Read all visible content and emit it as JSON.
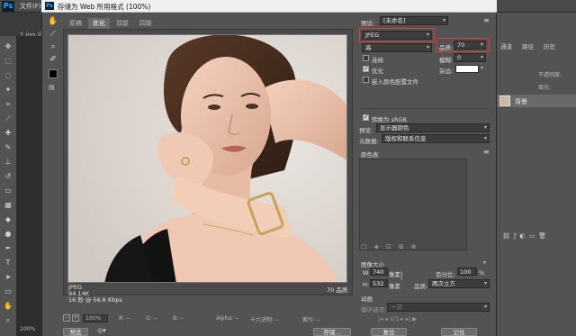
{
  "app": {
    "logo": "Ps",
    "menu_file": "文件(F)",
    "doc_tab": "1.jpg @ 5",
    "zoom": "100%"
  },
  "dialog": {
    "title": "存储为 Web 所用格式 (100%)",
    "tabs": [
      {
        "label": "原稿"
      },
      {
        "label": "优化"
      },
      {
        "label": "双联"
      },
      {
        "label": "四联"
      }
    ],
    "info": {
      "format": "JPEG",
      "size": "94.14K",
      "download": "16 秒 @ 56.6 Kbps",
      "quality": "70 品质"
    },
    "bottom_bar": {
      "zoom": "100%",
      "r": "R: --",
      "g": "G: --",
      "b": "B: --",
      "alpha": "Alpha: --",
      "hex": "十六进制: --",
      "index": "索引: --"
    },
    "buttons": {
      "preview": "预览",
      "save": "存储...",
      "reset": "复位",
      "remember": "记住"
    }
  },
  "settings": {
    "preset_label": "预设:",
    "preset_value": "[未命名]",
    "format_value": "JPEG",
    "compression_value": "高",
    "quality_label": "品质:",
    "quality_value": "70",
    "progressive_label": "连续",
    "blur_label": "模糊:",
    "blur_value": "0",
    "optimized_label": "优化",
    "matte_label": "杂边:",
    "embed_profile_label": "嵌入颜色配置文件",
    "convert_srgb_label": "转换为 sRGB",
    "preview_label": "预览:",
    "preview_value": "显示器颜色",
    "metadata_label": "元数据:",
    "metadata_value": "版权和联系信息",
    "color_table_label": "颜色表",
    "image_size_label": "图像大小",
    "width_label": "W:",
    "width_value": "740",
    "height_label": "H:",
    "height_value": "532",
    "px_label": "像素",
    "percent_label": "百分比:",
    "percent_value": "100",
    "percent_unit": "%",
    "quality2_label": "品质:",
    "quality2_value": "两次立方",
    "animation_label": "动画",
    "loop_label": "循环选项:",
    "loop_value": "一次",
    "frame_counter": "1/1"
  },
  "layers_panel": {
    "tabs": [
      "通道",
      "路径",
      "历史"
    ],
    "opacity_label": "不透明度:",
    "fill_label": "填充:",
    "layer_name": "背景"
  },
  "colors": {
    "highlight": "#e53935",
    "dialog_bg": "#535353"
  }
}
